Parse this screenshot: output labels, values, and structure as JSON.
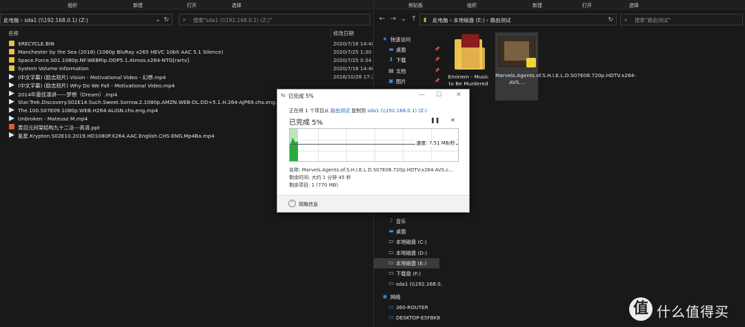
{
  "left_window": {
    "ribbon": [
      "组织",
      "新建",
      "打开",
      "选择"
    ],
    "address": "此电脑 › sda1 (\\\\192.168.0.1) (Z:)",
    "search_placeholder": "搜索\"sda1 (\\\\192.168.0.1) (Z:)\"",
    "col_name": "名称",
    "col_date": "修改日期",
    "files": [
      {
        "icon": "folder",
        "name": "$RECYCLE.BIN",
        "date": "2020/7/16 14:48"
      },
      {
        "icon": "folder",
        "name": "Manchester by the Sea (2016) (1080p BluRay x265 HEVC 10bit AAC 5.1 Silence)",
        "date": "2020/7/25 1:30"
      },
      {
        "icon": "folder",
        "name": "Space.Force.S01.1080p.NF.WEBRip.DDP5.1.Atmos.x264-NTG[rartv]",
        "date": "2020/7/25 0:34"
      },
      {
        "icon": "folder",
        "name": "System Volume Information",
        "date": "2020/7/16 14:46"
      },
      {
        "icon": "video",
        "name": "(中文字幕) (励志短片) Vision - Motivational Video - 幻想.mp4",
        "date": "2016/10/26 17:25"
      },
      {
        "icon": "video",
        "name": "(中文字幕) (励志短片) Why Do We Fall - Motivational Video.mp4",
        "date": ""
      },
      {
        "icon": "video",
        "name": "2014年最佳演讲——梦想（Dream）.mp4",
        "date": ""
      },
      {
        "icon": "video",
        "name": "Star.Trek.Discovery.S02E14.Such.Sweet.Sorrow.2.1080p.AMZN.WEB-DL.DD+5.1.H.264-AJP69.chs.eng.mp4",
        "date": ""
      },
      {
        "icon": "video",
        "name": "The.100.S07E09.1080p.WEB.H264-ALiGN.chs.eng.mp4",
        "date": ""
      },
      {
        "icon": "video",
        "name": "Unbroken - Mateusz M.mp4",
        "date": ""
      },
      {
        "icon": "ppt",
        "name": "黄自元间架结构九十二法---高清.ppt",
        "date": ""
      },
      {
        "icon": "video",
        "name": "氪星.Krypton.S02E10.2019.HD1080P.X264.AAC.English.CHS-ENG.Mp4Ba.mp4",
        "date": ""
      }
    ]
  },
  "right_window": {
    "ribbon": [
      "剪贴板",
      "组织",
      "新建",
      "打开",
      "选择"
    ],
    "address": "此电脑 › 本地磁盘 (E:) › 路由测试",
    "search_placeholder": "搜索\"路由测试\"",
    "nav": [
      {
        "icon": "star-icon",
        "label": "快速访问",
        "pinned": false,
        "indent": 0
      },
      {
        "icon": "desktop-icon",
        "label": "桌面",
        "pinned": true,
        "indent": 1
      },
      {
        "icon": "download-icon",
        "label": "下载",
        "pinned": true,
        "indent": 1
      },
      {
        "icon": "document-icon",
        "label": "文档",
        "pinned": true,
        "indent": 1
      },
      {
        "icon": "picture-icon",
        "label": "图片",
        "pinned": true,
        "indent": 1
      }
    ],
    "nav_lower": [
      {
        "icon": "music-icon",
        "label": "音乐",
        "selected": false,
        "indent": 1
      },
      {
        "icon": "desktop-icon",
        "label": "桌面",
        "selected": false,
        "indent": 1
      },
      {
        "icon": "drive-icon",
        "label": "本地磁盘 (C:)",
        "selected": false,
        "indent": 1
      },
      {
        "icon": "drive-icon",
        "label": "本地磁盘 (D:)",
        "selected": false,
        "indent": 1
      },
      {
        "icon": "drive-icon",
        "label": "本地磁盘 (E:)",
        "selected": true,
        "indent": 1
      },
      {
        "icon": "drive-icon",
        "label": "下载盘 (F:)",
        "selected": false,
        "indent": 1
      },
      {
        "icon": "network-drive-icon",
        "label": "sda1 (\\\\192.168.0.",
        "selected": false,
        "indent": 1
      }
    ],
    "nav_network": [
      {
        "icon": "network-icon",
        "label": "网络",
        "indent": 0
      },
      {
        "icon": "computer-icon",
        "label": "360-ROUTER",
        "indent": 1
      },
      {
        "icon": "computer-icon",
        "label": "DESKTOP-E5FBK8",
        "indent": 1
      }
    ],
    "items": [
      {
        "name": "Eminem - Music to Be Murdered",
        "type": "folder"
      },
      {
        "name": "Marvels.Agents.of.S.H.I.E.L.D.S07E08.720p.HDTV.x264-AVS....",
        "type": "video"
      }
    ]
  },
  "dialog": {
    "title": "已完成 5%",
    "line_prefix": "正在将 1 个项目从 ",
    "line_source": "路由测试",
    "line_mid": " 复制到 ",
    "line_dest": "sda1 (\\\\192.168.0.1) (Z:)",
    "status": "已完成 5%",
    "progress_percent": 5,
    "speed": "速度: 7.51 MB/秒",
    "name_line": "名称: Marvels.Agents.of.S.H.I.E.L.D.S07E08.720p.HDTV.x264-AVS.c...",
    "time_line": "剩余时间: 大约 1 分钟 45 秒",
    "items_line": "剩余项目: 1 (770 MB)",
    "details": "简略信息"
  },
  "watermark": {
    "text": "什么值得买",
    "logo": "值"
  },
  "colors": {
    "background": "#191919",
    "dialog": "#ffffff",
    "graph_fill": "#bfe6bf",
    "graph_spike": "#2bab3a",
    "folder": "#e7bf4a",
    "link": "#1a64c4"
  }
}
